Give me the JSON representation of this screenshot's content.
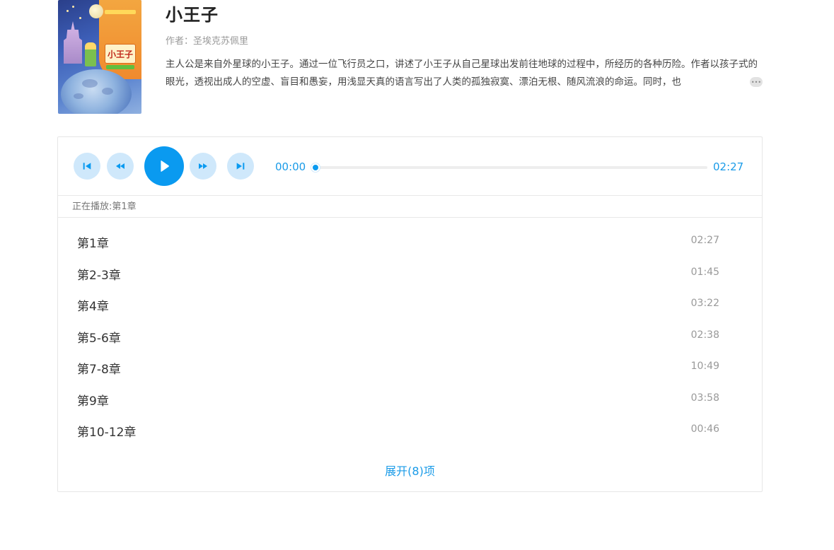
{
  "book": {
    "title": "小王子",
    "author": "作者：圣埃克苏佩里",
    "description": "主人公是来自外星球的小王子。通过一位飞行员之口，讲述了小王子从自己星球出发前往地球的过程中，所经历的各种历险。作者以孩子式的眼光，透视出成人的空虚、盲目和愚妄，用浅显天真的语言写出了人类的孤独寂寞、漂泊无根、随风流浪的命运。同时，也",
    "more_label": "•••",
    "cover_title": "小王子"
  },
  "player": {
    "current_time": "00:00",
    "total_time": "02:27",
    "progress": 0.0,
    "now_playing": "正在播放:第1章",
    "buttons": {
      "prev_icon": "skip-previous-icon",
      "rewind_icon": "rewind-icon",
      "play_icon": "play-icon",
      "forward_icon": "fast-forward-icon",
      "next_icon": "skip-next-icon"
    }
  },
  "tracks": [
    {
      "title": "第1章",
      "duration": "02:27"
    },
    {
      "title": "第2-3章",
      "duration": "01:45"
    },
    {
      "title": "第4章",
      "duration": "03:22"
    },
    {
      "title": "第5-6章",
      "duration": "02:38"
    },
    {
      "title": "第7-8章",
      "duration": "10:49"
    },
    {
      "title": "第9章",
      "duration": "03:58"
    },
    {
      "title": "第10-12章",
      "duration": "00:46"
    }
  ],
  "expand_label": "展开(8)项",
  "colors": {
    "accent": "#0a9af0",
    "accent_light": "#cfe8fb",
    "text": "#333333",
    "muted": "#999999"
  }
}
